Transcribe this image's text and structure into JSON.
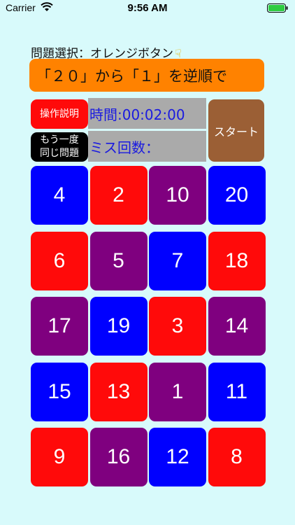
{
  "status_bar": {
    "carrier": "Carrier",
    "time": "9:56 AM"
  },
  "instruction": {
    "text": "問題選択：オレンジボタン",
    "icon": "pointing-hand-icon"
  },
  "problem": {
    "text": "「２０」から「１」を逆順で"
  },
  "buttons": {
    "help": "操作説明",
    "retry_line1": "もう一度",
    "retry_line2": "同じ問題",
    "start": "スタート"
  },
  "panels": {
    "timer": "時間:00:02:00",
    "misses": "ミス回数："
  },
  "colors": {
    "red": "#ff0a0a",
    "blue": "#0000ff",
    "purple": "#7f007f",
    "orange": "#ff8200",
    "brown": "#9b5f35"
  },
  "tiles": [
    {
      "label": "4",
      "color": "blue"
    },
    {
      "label": "2",
      "color": "red"
    },
    {
      "label": "10",
      "color": "purple"
    },
    {
      "label": "20",
      "color": "blue"
    },
    {
      "label": "6",
      "color": "red"
    },
    {
      "label": "5",
      "color": "purple"
    },
    {
      "label": "7",
      "color": "blue"
    },
    {
      "label": "18",
      "color": "red"
    },
    {
      "label": "17",
      "color": "purple"
    },
    {
      "label": "19",
      "color": "blue"
    },
    {
      "label": "3",
      "color": "red"
    },
    {
      "label": "14",
      "color": "purple"
    },
    {
      "label": "15",
      "color": "blue"
    },
    {
      "label": "13",
      "color": "red"
    },
    {
      "label": "1",
      "color": "purple"
    },
    {
      "label": "11",
      "color": "blue"
    },
    {
      "label": "9",
      "color": "red"
    },
    {
      "label": "16",
      "color": "purple"
    },
    {
      "label": "12",
      "color": "blue"
    },
    {
      "label": "8",
      "color": "red"
    }
  ]
}
